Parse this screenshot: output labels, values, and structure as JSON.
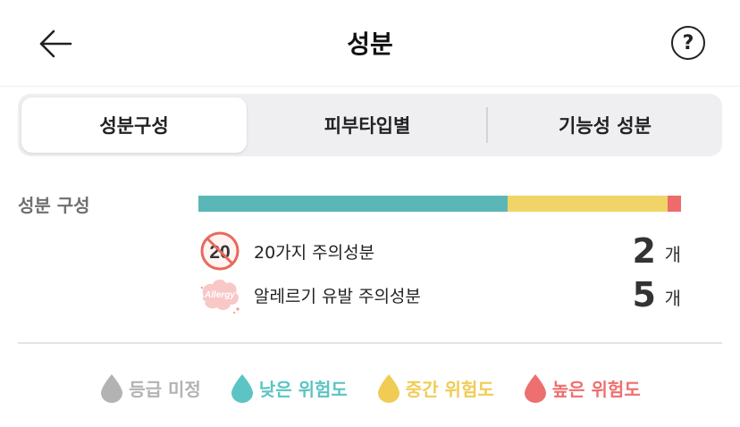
{
  "header": {
    "title": "성분"
  },
  "tabs": [
    {
      "label": "성분구성"
    },
    {
      "label": "피부타입별"
    },
    {
      "label": "기능성 성분"
    }
  ],
  "composition": {
    "label": "성분 구성",
    "bar": [
      {
        "color": "#5bb7b7",
        "fraction": 0.64
      },
      {
        "color": "#f0d468",
        "fraction": 0.333
      },
      {
        "color": "#ee6b6b",
        "fraction": 0.027
      }
    ],
    "rows": [
      {
        "icon": "no-20-icon",
        "icon_text": "20",
        "label": "20가지 주의성분",
        "count": "2",
        "unit": "개"
      },
      {
        "icon": "allergy-icon",
        "icon_text": "Allergy",
        "label": "알레르기 유발 주의성분",
        "count": "5",
        "unit": "개"
      }
    ]
  },
  "legend": [
    {
      "label": "등급 미정",
      "color": "#b3b3b3"
    },
    {
      "label": "낮은 위험도",
      "color": "#5cc4c4"
    },
    {
      "label": "중간 위험도",
      "color": "#f0cc55"
    },
    {
      "label": "높은 위험도",
      "color": "#ee6f6f"
    }
  ]
}
